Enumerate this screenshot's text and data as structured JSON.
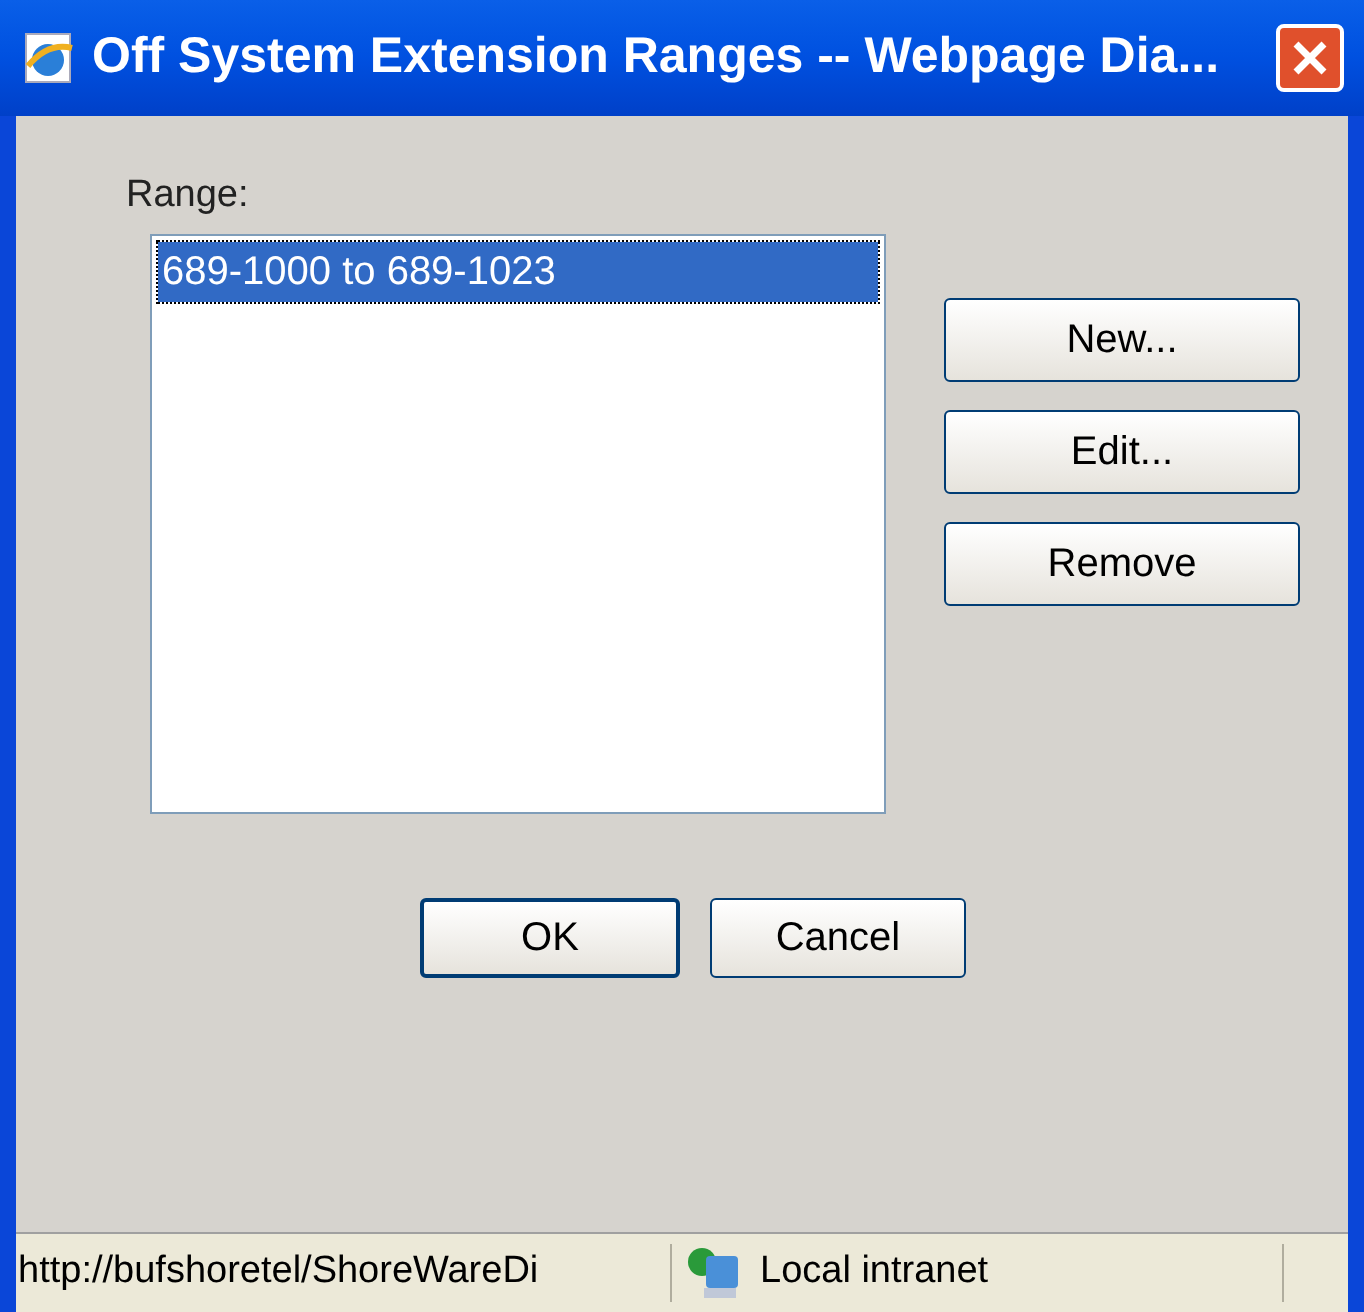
{
  "window": {
    "title": "Off System Extension Ranges -- Webpage Dia..."
  },
  "range": {
    "label": "Range:",
    "items": [
      {
        "text": "689-1000 to 689-1023",
        "selected": true
      }
    ]
  },
  "side_buttons": [
    "New...",
    "Edit...",
    "Remove"
  ],
  "buttons": [
    "OK",
    "Cancel"
  ],
  "status_bar": {
    "url": "http://bufshoretel/ShoreWareDi",
    "zone": "Local intranet"
  }
}
